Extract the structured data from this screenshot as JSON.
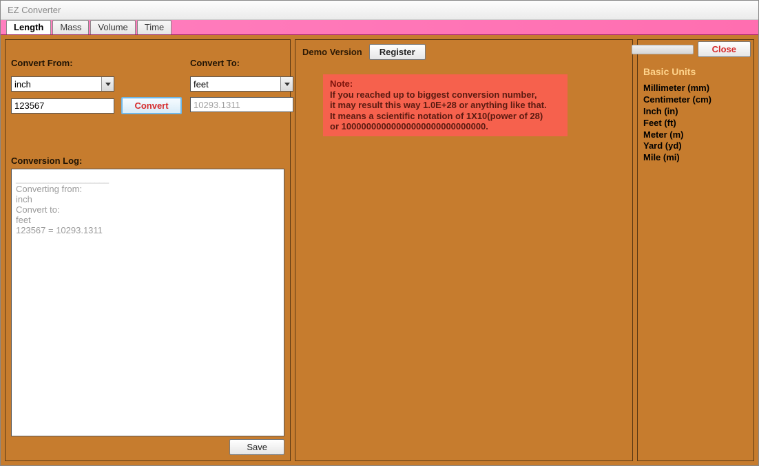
{
  "window": {
    "title": "EZ Converter"
  },
  "tabs": {
    "length": "Length",
    "mass": "Mass",
    "volume": "Volume",
    "time": "Time"
  },
  "header": {
    "demo_label": "Demo Version",
    "register_label": "Register",
    "close_label": "Close"
  },
  "form": {
    "from_label": "Convert From:",
    "to_label": "Convert To:",
    "from_value": "inch",
    "to_value": "feet",
    "input_value": "123567",
    "output_value": "10293.1311",
    "convert_label": "Convert"
  },
  "log": {
    "label": "Conversion Log:",
    "divider": "____________________",
    "line1": "Converting from:",
    "line2": "inch",
    "line3": "Convert to:",
    "line4": "feet",
    "line5": "123567 = 10293.1311",
    "save_label": "Save"
  },
  "note": {
    "title": "Note:",
    "line1": "If you reached up to biggest conversion number,",
    "line2": "it may result this way 1.0E+28 or anything like that.",
    "line3": "It means a scientific notation of 1X10(power of 28)",
    "line4": "or 10000000000000000000000000000."
  },
  "sidebar": {
    "title": "Basic Units",
    "units": [
      "Millimeter (mm)",
      "Centimeter (cm)",
      "Inch (in)",
      "Feet (ft)",
      "Meter (m)",
      "Yard (yd)",
      "Mile (mi)"
    ]
  }
}
